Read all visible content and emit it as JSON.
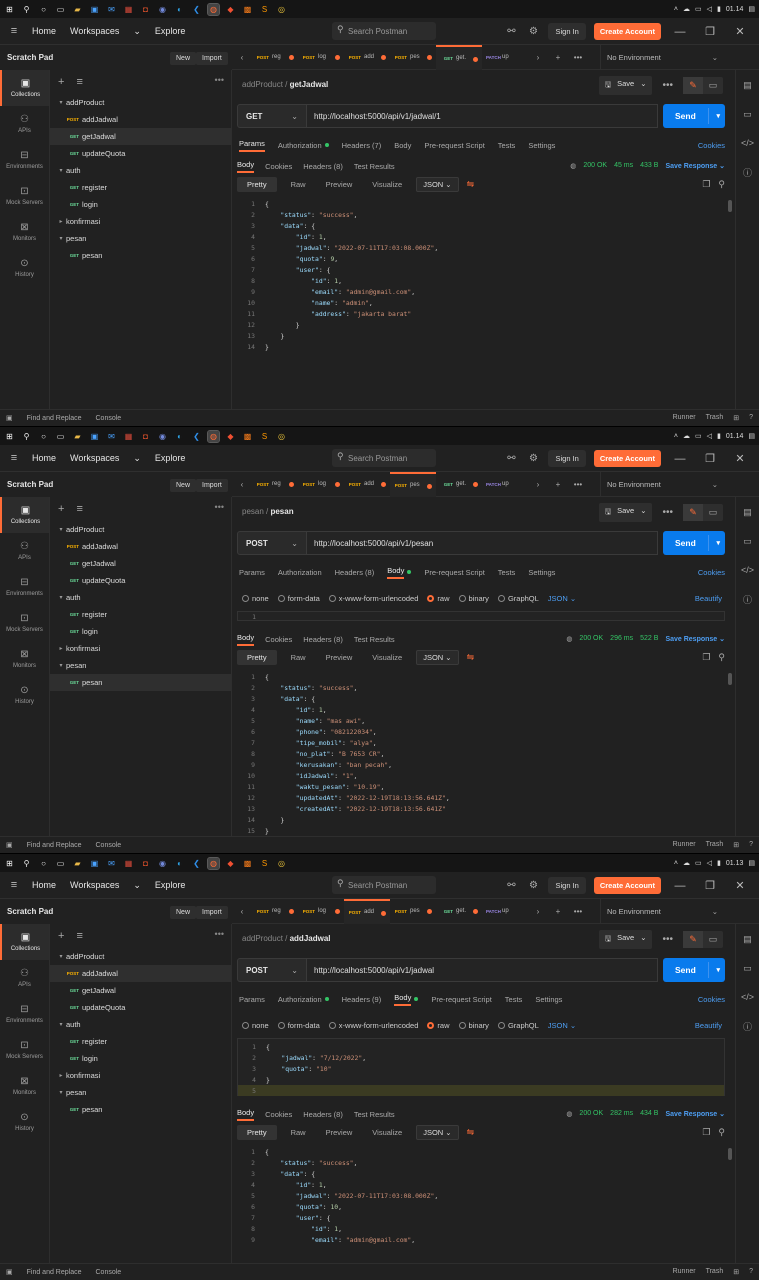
{
  "taskbar": {
    "icons": [
      "windows-icon",
      "search-icon",
      "cortana-icon",
      "taskview-icon",
      "explorer-icon",
      "store-icon",
      "mail-icon",
      "calendar-icon",
      "office-icon",
      "discord-icon",
      "edge-icon",
      "vscode-icon",
      "postman-icon",
      "git-icon",
      "xampp-icon",
      "sublime-icon",
      "chrome-icon"
    ],
    "times": [
      "01.14",
      "01.14",
      "01.13"
    ]
  },
  "app": {
    "nav": [
      "Home",
      "Workspaces",
      "Explore"
    ],
    "search_placeholder": "Search Postman",
    "sign_in": "Sign In",
    "create_account": "Create Account",
    "scratch_pad": "Scratch Pad",
    "new": "New",
    "import": "Import",
    "no_environment": "No Environment",
    "left_nav": [
      "Collections",
      "APIs",
      "Environments",
      "Mock Servers",
      "Monitors",
      "History"
    ],
    "footer_left": [
      "Find and Replace",
      "Console"
    ],
    "footer_right": [
      "Runner",
      "Trash"
    ],
    "save": "Save",
    "send": "Send",
    "cookies": "Cookies",
    "beautify": "Beautify",
    "save_response": "Save Response",
    "req_tabs": [
      "Params",
      "Authorization",
      "Headers",
      "Body",
      "Pre-request Script",
      "Tests",
      "Settings"
    ],
    "resp_tabs": [
      "Body",
      "Cookies",
      "Headers (8)",
      "Test Results"
    ],
    "view_modes": [
      "Pretty",
      "Raw",
      "Preview",
      "Visualize"
    ],
    "json": "JSON",
    "body_modes": [
      "none",
      "form-data",
      "x-www-form-urlencoded",
      "raw",
      "binary",
      "GraphQL"
    ]
  },
  "tree": [
    {
      "type": "folder",
      "label": "addProduct",
      "open": true
    },
    {
      "type": "req",
      "method": "POST",
      "label": "addJadwal"
    },
    {
      "type": "req",
      "method": "GET",
      "label": "getJadwal"
    },
    {
      "type": "req",
      "method": "GET",
      "label": "updateQuota"
    },
    {
      "type": "folder",
      "label": "auth",
      "open": true
    },
    {
      "type": "req",
      "method": "GET",
      "label": "register"
    },
    {
      "type": "req",
      "method": "GET",
      "label": "login"
    },
    {
      "type": "folder",
      "label": "konfirmasi",
      "open": false
    },
    {
      "type": "folder",
      "label": "pesan",
      "open": true
    },
    {
      "type": "req",
      "method": "GET",
      "label": "pesan"
    }
  ],
  "tabs": [
    {
      "method": "POST",
      "label": "reg"
    },
    {
      "method": "POST",
      "label": "log"
    },
    {
      "method": "POST",
      "label": "add"
    },
    {
      "method": "POST",
      "label": "pes"
    },
    {
      "method": "GET",
      "label": "get."
    },
    {
      "method": "PATCH",
      "label": "up"
    }
  ],
  "shots": [
    {
      "crumb_parent": "addProduct",
      "crumb_name": "getJadwal",
      "method": "GET",
      "url": "http://localhost:5000/api/v1/jadwal/1",
      "headers_count": "Headers (7)",
      "active_req_tab": "Params",
      "status": "200 OK",
      "time": "45 ms",
      "size": "433 B",
      "selected_tree": 2,
      "active_tab": 4,
      "response_lines": [
        "{",
        "    \"status\": \"success\",",
        "    \"data\": {",
        "        \"id\": 1,",
        "        \"jadwal\": \"2022-07-11T17:03:08.000Z\",",
        "        \"quota\": 9,",
        "        \"user\": {",
        "            \"id\": 1,",
        "            \"email\": \"admin@gmail.com\",",
        "            \"name\": \"admin\",",
        "            \"address\": \"jakarta barat\"",
        "        }",
        "    }",
        "}"
      ]
    },
    {
      "crumb_parent": "pesan",
      "crumb_name": "pesan",
      "method": "POST",
      "url": "http://localhost:5000/api/v1/pesan",
      "headers_count": "Headers (8)",
      "active_req_tab": "Body",
      "status": "200 OK",
      "time": "296 ms",
      "size": "522 B",
      "selected_tree": 9,
      "active_tab": 3,
      "request_lines": [
        "1"
      ],
      "response_lines": [
        "{",
        "    \"status\": \"success\",",
        "    \"data\": {",
        "        \"id\": 1,",
        "        \"name\": \"mas awi\",",
        "        \"phone\": \"082122034\",",
        "        \"tipe_mobil\": \"alya\",",
        "        \"no_plat\": \"B 7653 CR\",",
        "        \"kerusakan\": \"ban pecah\",",
        "        \"idJadwal\": \"1\",",
        "        \"waktu_pesan\": \"10.19\",",
        "        \"updatedAt\": \"2022-12-19T18:13:56.641Z\",",
        "        \"createdAt\": \"2022-12-19T18:13:56.641Z\"",
        "    }",
        "}"
      ]
    },
    {
      "crumb_parent": "addProduct",
      "crumb_name": "addJadwal",
      "method": "POST",
      "url": "http://localhost:5000/api/v1/jadwal",
      "headers_count": "Headers (9)",
      "active_req_tab": "Body",
      "status": "200 OK",
      "time": "282 ms",
      "size": "434 B",
      "selected_tree": 1,
      "active_tab": 2,
      "request_lines": [
        "{",
        "    \"jadwal\": \"7/12/2022\",",
        "    \"quota\": \"10\"",
        "}",
        ""
      ],
      "response_lines": [
        "{",
        "    \"status\": \"success\",",
        "    \"data\": {",
        "        \"id\": 1,",
        "        \"jadwal\": \"2022-07-11T17:03:08.000Z\",",
        "        \"quota\": 10,",
        "        \"user\": {",
        "            \"id\": 1,",
        "            \"email\": \"admin@gmail.com\","
      ]
    }
  ],
  "colors": {
    "accent": "#ff6c37",
    "send": "#097bed",
    "ok": "#34c566",
    "link": "#4d9ef3",
    "bg": "#212121"
  }
}
